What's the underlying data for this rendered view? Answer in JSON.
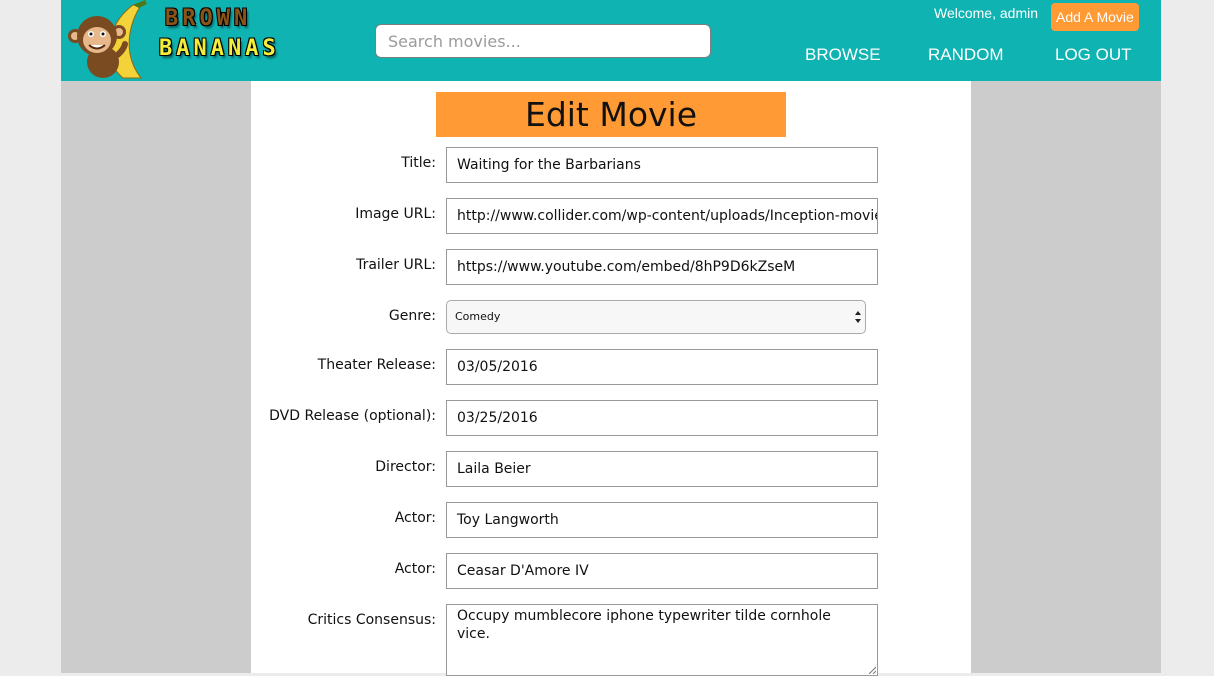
{
  "brand": {
    "line1": "BROWN",
    "line2": "BANANAS"
  },
  "search": {
    "placeholder": "Search movies..."
  },
  "user": {
    "welcome": "Welcome, admin",
    "add_movie": "Add A Movie"
  },
  "nav": {
    "browse": "BROWSE",
    "random": "RANDOM",
    "logout": "LOG OUT"
  },
  "form": {
    "heading": "Edit Movie",
    "title": {
      "label": "Title:",
      "value": "Waiting for the Barbarians"
    },
    "image_url": {
      "label": "Image URL:",
      "value": "http://www.collider.com/wp-content/uploads/Inception-movie"
    },
    "trailer_url": {
      "label": "Trailer URL:",
      "value": "https://www.youtube.com/embed/8hP9D6kZseM"
    },
    "genre": {
      "label": "Genre:",
      "value": "Comedy"
    },
    "theater_release": {
      "label": "Theater Release:",
      "value": "03/05/2016"
    },
    "dvd_release": {
      "label": "DVD Release (optional):",
      "value": "03/25/2016"
    },
    "director": {
      "label": "Director:",
      "value": "Laila Beier"
    },
    "actor1": {
      "label": "Actor:",
      "value": "Toy Langworth"
    },
    "actor2": {
      "label": "Actor:",
      "value": "Ceasar D'Amore IV"
    },
    "critics_consensus": {
      "label": "Critics Consensus:",
      "value": "Occupy mumblecore iphone typewriter tilde cornhole vice."
    }
  },
  "colors": {
    "navbar": "#0eb3b2",
    "accent": "#ff9a35",
    "sidebar": "#cccccc",
    "page_bg": "#ececec"
  },
  "icons": {
    "logo": "monkey-banana-logo",
    "select": "select-arrows-icon",
    "resize": "resize-grip-icon"
  }
}
